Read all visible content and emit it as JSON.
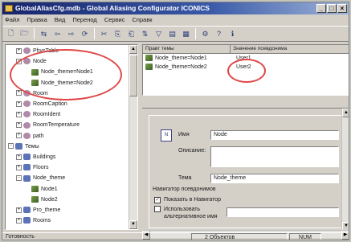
{
  "window": {
    "title": "GlobalAliasCfg.mdb - Global Aliasing Configurator ICONICS",
    "controls": [
      "_",
      "□",
      "×"
    ]
  },
  "menu": [
    "Файл",
    "Правка",
    "Вид",
    "Перенод",
    "Сервис",
    "Справк"
  ],
  "toolbar": {
    "icons": [
      "new-icon",
      "open-icon",
      "connect-icon",
      "back-icon",
      "forward-icon",
      "refresh-icon",
      "cut-icon",
      "copy-icon",
      "paste-icon",
      "sort-icon",
      "filter-icon",
      "list-icon",
      "details-icon",
      "properties-icon",
      "help-icon",
      "about-icon"
    ],
    "glyphs": [
      "🗋",
      "🗁",
      "⇆",
      "⇦",
      "⇨",
      "⟳",
      "✂",
      "⎘",
      "⎗",
      "⇅",
      "▽",
      "▤",
      "▦",
      "⚙",
      "?",
      "ℹ"
    ]
  },
  "tree": {
    "items": [
      {
        "label": "PhysTable",
        "indent": 1,
        "kind": "folder",
        "exp": "+"
      },
      {
        "label": "Node",
        "indent": 1,
        "kind": "folder",
        "exp": "-"
      },
      {
        "label": "Node_theme=Node1",
        "indent": 2,
        "kind": "node",
        "exp": ""
      },
      {
        "label": "Node_theme=Node2",
        "indent": 2,
        "kind": "node",
        "exp": ""
      },
      {
        "label": "Room",
        "indent": 1,
        "kind": "folder",
        "exp": "+"
      },
      {
        "label": "RoomCaption",
        "indent": 1,
        "kind": "folder",
        "exp": "+"
      },
      {
        "label": "RoomIdent",
        "indent": 1,
        "kind": "folder",
        "exp": "+"
      },
      {
        "label": "RoomTemperature",
        "indent": 1,
        "kind": "folder",
        "exp": "+"
      },
      {
        "label": "path",
        "indent": 1,
        "kind": "folder",
        "exp": "+"
      },
      {
        "label": "Темы",
        "indent": 0,
        "kind": "theme",
        "exp": "-"
      },
      {
        "label": "Buildings",
        "indent": 1,
        "kind": "theme",
        "exp": "+"
      },
      {
        "label": "Floors",
        "indent": 1,
        "kind": "theme",
        "exp": "+"
      },
      {
        "label": "Node_theme",
        "indent": 1,
        "kind": "theme",
        "exp": "-"
      },
      {
        "label": "Node1",
        "indent": 2,
        "kind": "node",
        "exp": ""
      },
      {
        "label": "Node2",
        "indent": 2,
        "kind": "node",
        "exp": ""
      },
      {
        "label": "Pro_theme",
        "indent": 1,
        "kind": "theme",
        "exp": "+"
      },
      {
        "label": "Rooms",
        "indent": 1,
        "kind": "theme",
        "exp": "+"
      }
    ]
  },
  "list": {
    "columns": [
      "Правт темы",
      "Значение псевдонима"
    ],
    "rows": [
      {
        "name": "Node_theme=Node1",
        "value": "User1"
      },
      {
        "name": "Node_theme=Node2",
        "value": "User2"
      }
    ]
  },
  "props": {
    "badge": "N",
    "name_label": "Имя",
    "name_value": "Node",
    "desc_label": "Описание:",
    "desc_value": "",
    "theme_label": "Тема",
    "theme_value": "Node_theme",
    "group_title": "Навигатор псевдонимов",
    "chk1_label": "Показать в Навигатор",
    "chk1_checked": "✓",
    "chk2_label": "Использовать альтернативное имя",
    "chk2_checked": ""
  },
  "status": {
    "left": "Готовность",
    "count": "2 Объектов",
    "mode": "NUM"
  },
  "annotation_color": "#e04848"
}
